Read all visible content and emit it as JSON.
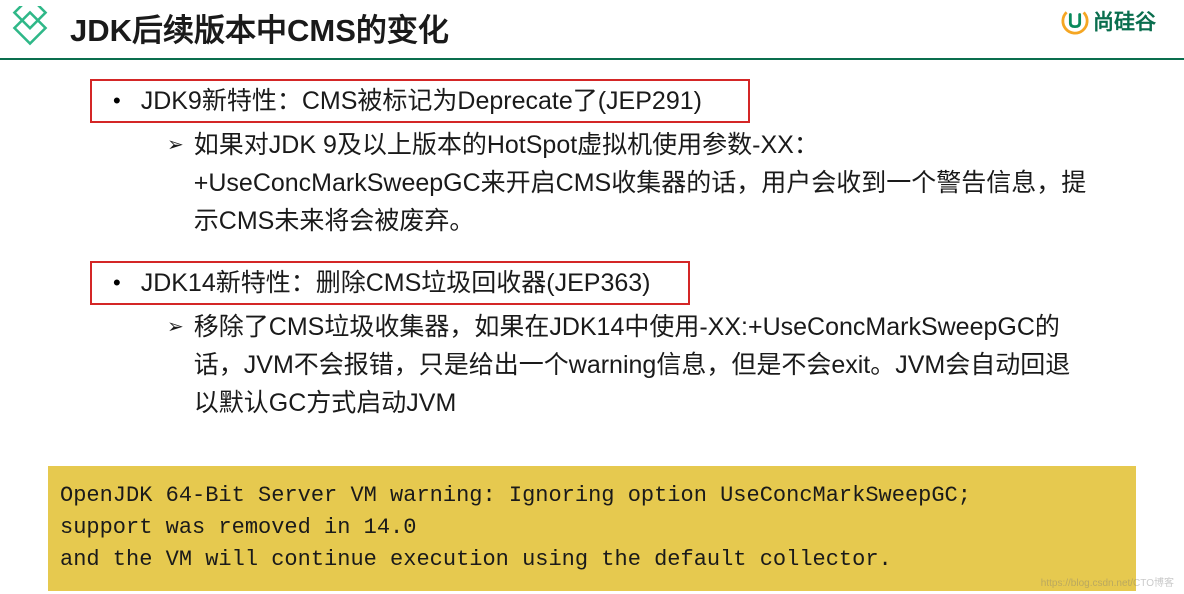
{
  "header": {
    "title": "JDK后续版本中CMS的变化",
    "brand_text": "尚硅谷"
  },
  "items": [
    {
      "bullet": "•",
      "title": "JDK9新特性：CMS被标记为Deprecate了(JEP291)",
      "sub": [
        {
          "arrow": "➢",
          "text": "如果对JDK 9及以上版本的HotSpot虚拟机使用参数-XX：+UseConcMarkSweepGC来开启CMS收集器的话，用户会收到一个警告信息，提示CMS未来将会被废弃。"
        }
      ]
    },
    {
      "bullet": "•",
      "title": "JDK14新特性：删除CMS垃圾回收器(JEP363)",
      "sub": [
        {
          "arrow": "➢",
          "text": "移除了CMS垃圾收集器，如果在JDK14中使用-XX:+UseConcMarkSweepGC的话，JVM不会报错，只是给出一个warning信息，但是不会exit。JVM会自动回退以默认GC方式启动JVM"
        }
      ]
    }
  ],
  "code": {
    "line1": "OpenJDK 64-Bit Server VM warning: Ignoring option UseConcMarkSweepGC;",
    "line2": "support was removed in 14.0",
    "line3": "and the VM will continue execution using the default collector."
  },
  "watermark": "https://blog.csdn.net/CTO博客"
}
